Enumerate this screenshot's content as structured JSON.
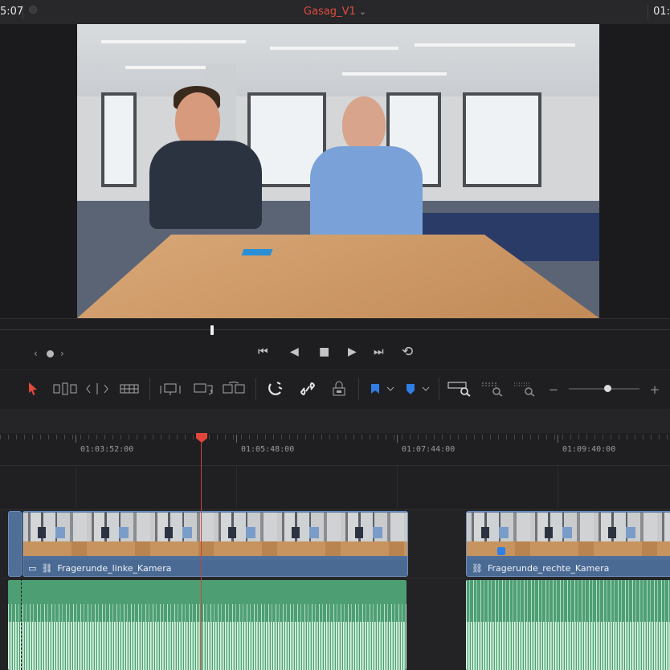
{
  "topbar": {
    "timecode_left": "5:07",
    "project_title": "Gasag_V1",
    "title_chevron": "⌄",
    "timecode_right": "01:"
  },
  "colors": {
    "accent_red": "#e24a3c",
    "clip_blue": "#4f6f99",
    "audio_green": "#4d9f73",
    "playhead": "#e2453a",
    "marker_blue": "#2f7fe6"
  },
  "viewer": {
    "image_description": "two men sitting at a wooden table in an office"
  },
  "transport": {
    "nav_prev_icon": "chevron-left-icon",
    "nav_next_icon": "chevron-right-icon",
    "buttons": [
      {
        "name": "jump-to-start-button",
        "glyph": "⏮"
      },
      {
        "name": "reverse-play-button",
        "glyph": "◀"
      },
      {
        "name": "stop-button",
        "glyph": "■"
      },
      {
        "name": "play-button",
        "glyph": "▶"
      },
      {
        "name": "jump-to-end-button",
        "glyph": "⏭"
      },
      {
        "name": "loop-button",
        "glyph": "⟲"
      }
    ]
  },
  "toolbar": {
    "zoom_level": 0.55
  },
  "ruler": {
    "timecodes": [
      "01:03:52:00",
      "01:05:48:00",
      "01:07:44:00",
      "01:09:40:00"
    ]
  },
  "timeline": {
    "video_clips": [
      {
        "label": "Fragerunde_linke_Kamera"
      },
      {
        "label": "Fragerunde_rechte_Kamera"
      }
    ]
  }
}
